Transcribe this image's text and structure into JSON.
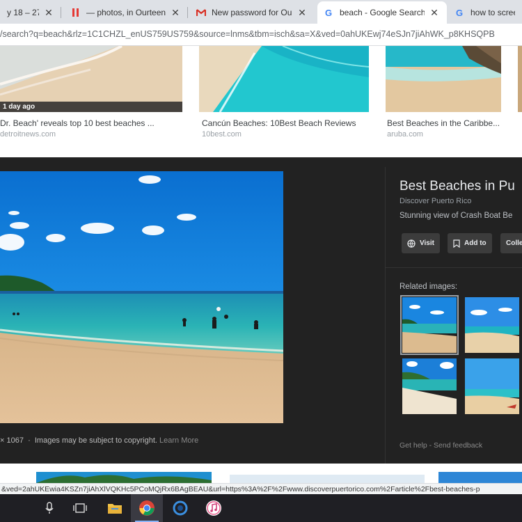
{
  "tabs": [
    {
      "title": "y 18 – 27 |",
      "icon": "calendar-icon",
      "active": false
    },
    {
      "title": "— photos, in Ourteen…",
      "icon": "red-bars-icon",
      "active": false
    },
    {
      "title": "New password for Ourt",
      "icon": "gmail-icon",
      "active": false
    },
    {
      "title": "beach - Google Search",
      "icon": "google-icon",
      "active": true
    },
    {
      "title": "how to screens…",
      "icon": "google-icon",
      "active": false
    }
  ],
  "address": {
    "url": "/search?q=beach&rlz=1C1CHZL_enUS759US759&source=lnms&tbm=isch&sa=X&ved=0ahUKEwj74eSJn7jiAhWK_p8KHSQPB"
  },
  "results": [
    {
      "title": "Dr. Beach' reveals top 10 best beaches ...",
      "domain": "detroitnews.com",
      "badge": "1 day ago"
    },
    {
      "title": "Cancún Beaches: 10Best Beach Reviews",
      "domain": "10best.com"
    },
    {
      "title": "Best Beaches in the Caribbe...",
      "domain": "aruba.com"
    }
  ],
  "preview": {
    "title": "Best Beaches in Pu",
    "source": "Discover Puerto Rico",
    "description": "Stunning view of Crash Boat Be",
    "buttons": {
      "visit": "Visit",
      "add_to": "Add to",
      "collections": "Colle"
    },
    "related_label": "Related images:",
    "footer_size": "× 1067",
    "footer_copyright": "Images may be subject to copyright.",
    "footer_learn_more": "Learn More",
    "get_help": "Get help",
    "separator": "-",
    "send_feedback": "Send feedback"
  },
  "status_url": "&ved=2ahUKEwia4KSZn7jiAhXlVQKHc5PCoMQjRx6BAgBEAU&url=https%3A%2F%2Fwww.discoverpuertorico.com%2Farticle%2Fbest-beaches-p",
  "taskbar": {
    "items": [
      "microphone-icon",
      "task-view-icon",
      "file-explorer-icon",
      "chrome-icon",
      "cortana-ring-icon",
      "itunes-icon"
    ],
    "active_index": 3
  },
  "colors": {
    "panel_bg": "#222222",
    "tab_strip": "#dee1e6",
    "taskbar": "#1f1f24"
  }
}
